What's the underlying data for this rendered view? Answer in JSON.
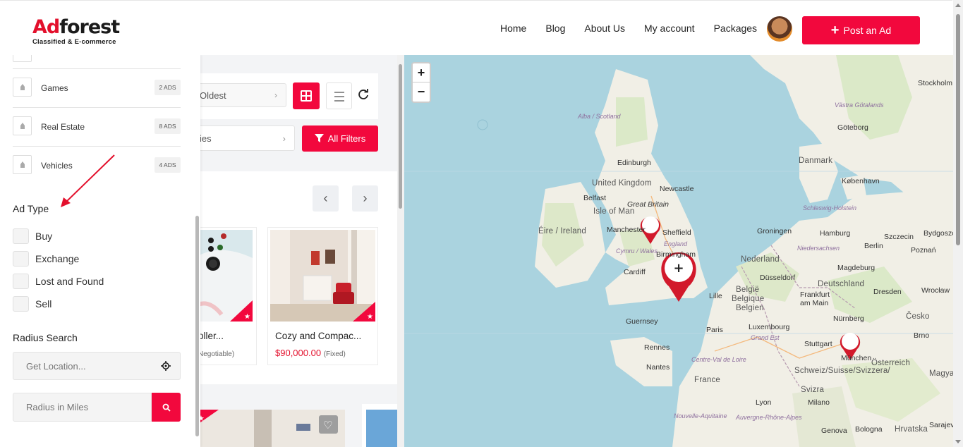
{
  "header": {
    "logo": {
      "ad": "Ad",
      "forest": "forest",
      "tagline": "Classified & E-commerce"
    },
    "nav": [
      "Home",
      "Blog",
      "About Us",
      "My account",
      "Packages"
    ],
    "post_button": {
      "icon": "plus-icon",
      "label": "Post an Ad"
    },
    "accent": "#f2083d"
  },
  "toolbar": {
    "sort_value": "Oldest",
    "category_value": "ies",
    "all_filters_label": "All Filters"
  },
  "listings": [
    {
      "title": "oller...",
      "price": "",
      "price_note": "Negotiable)"
    },
    {
      "title": "Cozy and Compac...",
      "price": "$90,000.00",
      "price_note": "(Fixed)"
    }
  ],
  "sidebar": {
    "categories": [
      {
        "label": "Games",
        "count": "2 ADS"
      },
      {
        "label": "Real Estate",
        "count": "8 ADS"
      },
      {
        "label": "Vehicles",
        "count": "4 ADS"
      }
    ],
    "ad_type_title": "Ad Type",
    "ad_types": [
      "Buy",
      "Exchange",
      "Lost and Found",
      "Sell"
    ],
    "radius_title": "Radius Search",
    "location_placeholder": "Get Location...",
    "radius_placeholder": "Radius in Miles"
  },
  "map": {
    "zoom_in": "+",
    "zoom_out": "−",
    "labels": {
      "stockholm": "Stockholm",
      "alba": "Alba / Scotland",
      "gotaland": "Västra Götalands",
      "goteborg": "Göteborg",
      "edinburgh": "Edinburgh",
      "danmark": "Danmark",
      "kobenhavn": "København",
      "uk": "United Kingdom",
      "newcastle": "Newcastle",
      "belfast": "Belfast",
      "isle": "Isle of Man",
      "gb": "Great Britain",
      "eire": "Éire / Ireland",
      "manchester": "Manchester",
      "sheffield": "Sheffield",
      "england": "England",
      "birmingham": "Birmingham",
      "cymru": "Cymru / Wales",
      "cardiff": "Cardiff",
      "groningen": "Groningen",
      "hamburg": "Hamburg",
      "szczecin": "Szczecin",
      "bydgoszcz": "Bydgoszcz",
      "berlin": "Berlin",
      "poznan": "Poznań",
      "niedersachsen": "Niedersachsen",
      "nederland": "Nederland",
      "magdeburg": "Magdeburg",
      "dusseldorf": "Düsseldorf",
      "deutschland": "Deutschland",
      "dresden": "Dresden",
      "wroclaw": "Wrocław",
      "belgie": "België",
      "belgique": "Belgique",
      "belgien": "Belgien",
      "lille": "Lille",
      "frankfurt": "Frankfurt",
      "ammain": "am Main",
      "cesko": "Česko",
      "nurnberg": "Nürnberg",
      "guernsey": "Guernsey",
      "luxembourg": "Luxembourg",
      "paris": "Paris",
      "brno": "Brno",
      "grandest": "Grand Est",
      "stuttgart": "Stuttgart",
      "munchen": "München",
      "osterreich": "Österreich",
      "rennes": "Rennes",
      "nantes": "Nantes",
      "france": "France",
      "schweiz": "Schweiz/Suisse/Svizzera/",
      "svizra": "Svizra",
      "magya": "Magya",
      "lyon": "Lyon",
      "milano": "Milano",
      "genova": "Genova",
      "bologna": "Bologna",
      "hrvatska": "Hrvatska",
      "sarajev": "Sarajev",
      "schleswig": "Schleswig-Holstein",
      "centre": "Centre-Val de Loire",
      "nouvelle": "Nouvelle-Aquitaine",
      "auvergne": "Auvergne-Rhône-Alpes",
      "cluster": "+"
    }
  }
}
